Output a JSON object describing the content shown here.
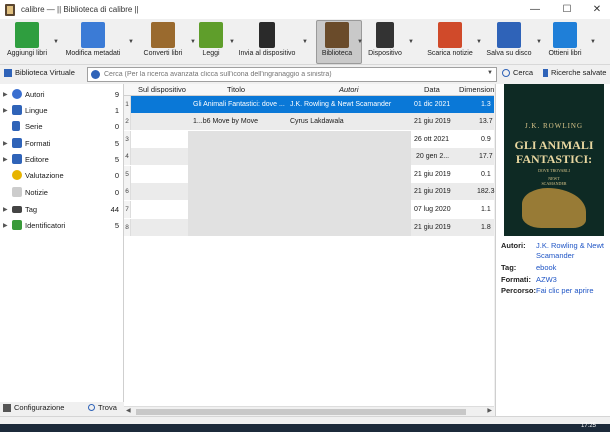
{
  "window": {
    "title": "calibre — || Biblioteca di calibre ||",
    "minimize": "—",
    "maximize": "☐",
    "close": "✕"
  },
  "toolbar": [
    {
      "label": "Aggiungi libri",
      "icon": "add-book-icon",
      "color": "#2f9e3f"
    },
    {
      "label": "Modifica metadati",
      "icon": "edit-metadata-icon",
      "color": "#3b7bd6"
    },
    {
      "label": "Converti libri",
      "icon": "convert-books-icon",
      "color": "#9a6a2e"
    },
    {
      "label": "Leggi",
      "icon": "read-glasses-icon",
      "color": "#5f9e2b"
    },
    {
      "label": "Invia al dispositivo",
      "icon": "send-device-icon",
      "color": "#2a2a2a"
    },
    {
      "label": "Biblioteca",
      "icon": "library-books-icon",
      "color": "#6a4b2a"
    },
    {
      "label": "Dispositivo",
      "icon": "ereader-icon",
      "color": "#333333"
    },
    {
      "label": "Scarica notizie",
      "icon": "news-icon",
      "color": "#d04a2a"
    },
    {
      "label": "Salva su disco",
      "icon": "save-disk-icon",
      "color": "#2f63b8"
    },
    {
      "label": "Ottieni libri",
      "icon": "get-books-icon",
      "color": "#1f7fd8"
    }
  ],
  "search": {
    "virtual_library": "Biblioteca Virtuale",
    "placeholder": "Cerca (Per la ricerca avanzata clicca sull'icona dell'ingranaggio a sinistra)",
    "search_button": "Cerca",
    "saved_searches": "Ricerche salvate"
  },
  "categories": [
    {
      "label": "Autori",
      "count": "9",
      "icon": "person-icon",
      "color": "#3a6fd0"
    },
    {
      "label": "Lingue",
      "count": "1",
      "icon": "language-icon",
      "color": "#2f63b8"
    },
    {
      "label": "Serie",
      "count": "0",
      "icon": "series-icon",
      "color": "#2f63b8"
    },
    {
      "label": "Formati",
      "count": "5",
      "icon": "formats-icon",
      "color": "#2f63b8"
    },
    {
      "label": "Editore",
      "count": "5",
      "icon": "publisher-icon",
      "color": "#2f63b8"
    },
    {
      "label": "Valutazione",
      "count": "0",
      "icon": "star-icon",
      "color": "#e7b400"
    },
    {
      "label": "Notizie",
      "count": "0",
      "icon": "news-icon",
      "color": "#cccccc"
    },
    {
      "label": "Tag",
      "count": "44",
      "icon": "tag-icon",
      "color": "#444444"
    },
    {
      "label": "Identificatori",
      "count": "5",
      "icon": "identifiers-icon",
      "color": "#3a9a3a"
    }
  ],
  "left_bottom": {
    "config": "Configurazione",
    "find": "Trova"
  },
  "table": {
    "headers": [
      "Sul dispositivo",
      "Titolo",
      "Autori",
      "Data",
      "Dimension"
    ],
    "rows": [
      {
        "n": "1",
        "title": "Gli Animali Fantastici: dove ...",
        "authors": "J.K. Rowling & Newt Scamander",
        "date": "01 dic 2021",
        "size": "1.3"
      },
      {
        "n": "2",
        "title": "1...b6 Move by Move",
        "authors": "Cyrus Lakdawala",
        "date": "21 giu 2019",
        "size": "13.7"
      },
      {
        "n": "3",
        "title": "",
        "authors": "",
        "date": "26 ott 2021",
        "size": "0.9"
      },
      {
        "n": "4",
        "title": "",
        "authors": "",
        "date": "20 gen 2...",
        "size": "17.7"
      },
      {
        "n": "5",
        "title": "",
        "authors": "",
        "date": "21 giu 2019",
        "size": "0.1"
      },
      {
        "n": "6",
        "title": "",
        "authors": "",
        "date": "21 giu 2019",
        "size": "182.3"
      },
      {
        "n": "7",
        "title": "",
        "authors": "",
        "date": "07 lug 2020",
        "size": "1.1"
      },
      {
        "n": "8",
        "title": "",
        "authors": "",
        "date": "21 giu 2019",
        "size": "1.8"
      }
    ]
  },
  "book": {
    "cover_author": "J.K. ROWLING",
    "cover_title_1": "GLI ANIMALI",
    "cover_title_2": "FANTASTICI:",
    "cover_sub_1": "DOVE TROVARLI",
    "cover_sub_2": "NEWT",
    "cover_sub_3": "SCAMANDER",
    "labels": {
      "authors": "Autori:",
      "tags": "Tag:",
      "formats": "Formati:",
      "path": "Percorso:"
    },
    "authors_1": "J.K. Rowling & Newt",
    "authors_2": "Scamander",
    "tags": "ebook",
    "formats": "AZW3",
    "path": "Fai clic per aprire"
  },
  "clock": "17:25"
}
